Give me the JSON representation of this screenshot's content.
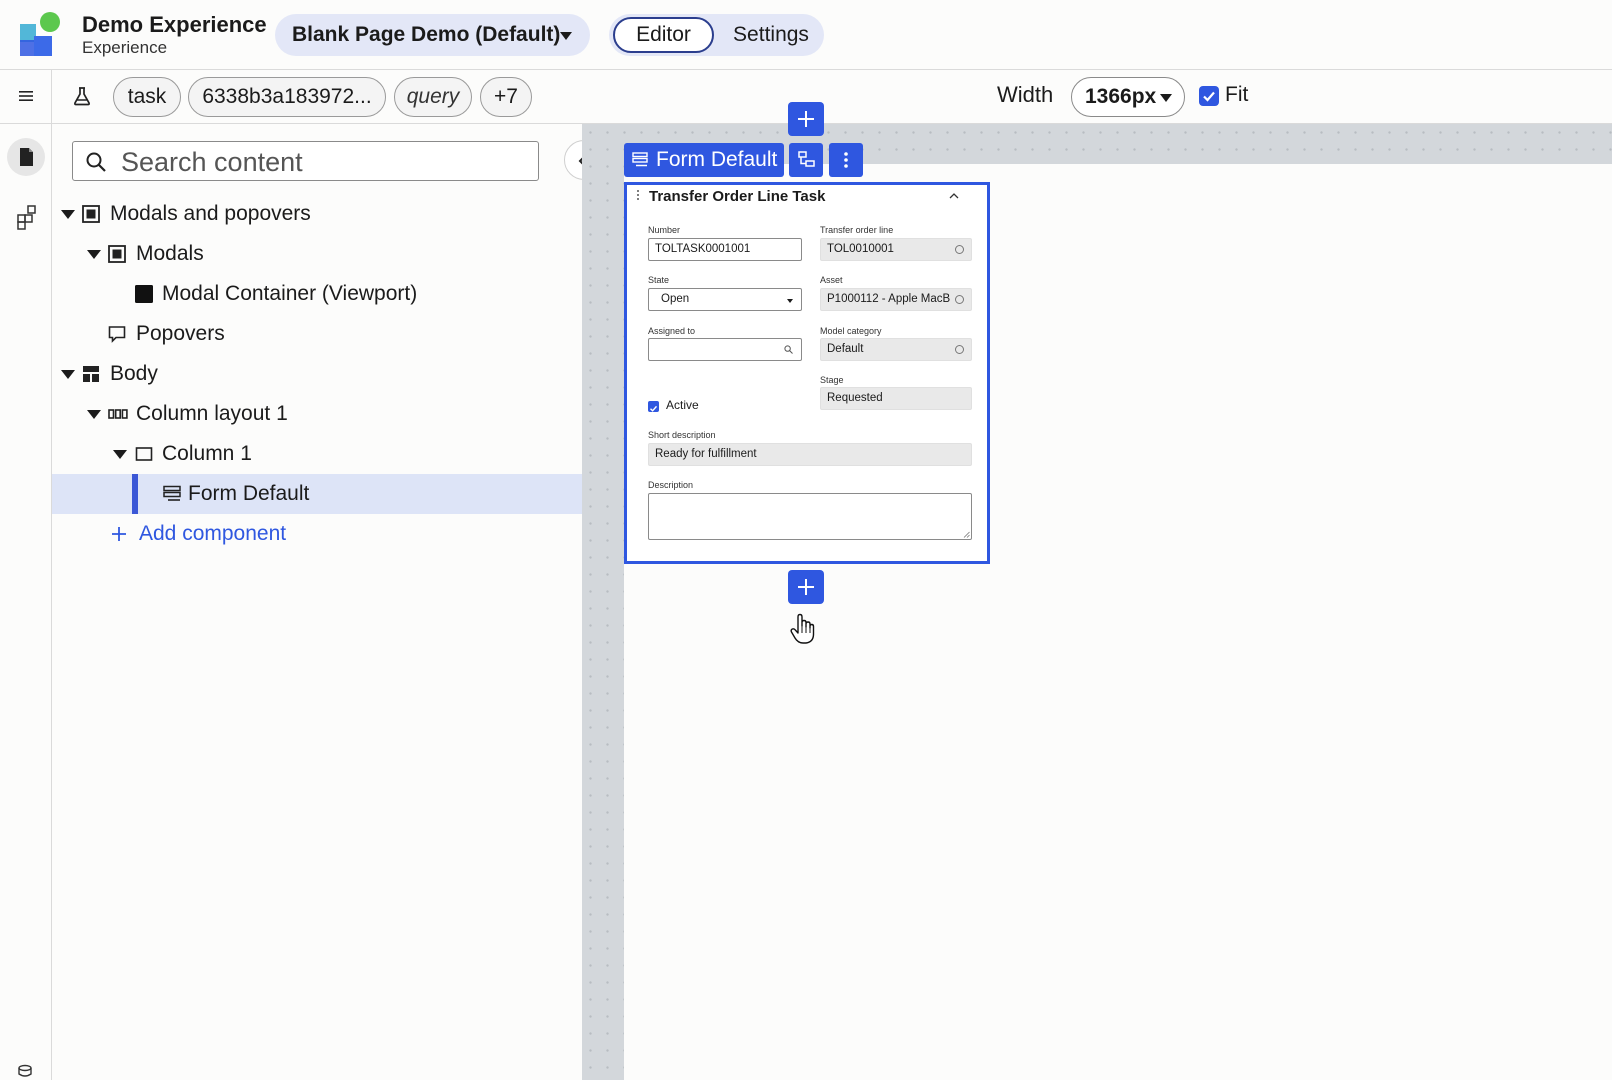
{
  "header": {
    "app_title": "Demo Experience",
    "app_subtitle": "Experience",
    "page_selector": "Blank Page Demo (Default)",
    "modes": {
      "editor": "Editor",
      "settings": "Settings"
    }
  },
  "toolbar": {
    "chips": [
      "task",
      "6338b3a183972...",
      "query",
      "+7"
    ],
    "width_label": "Width",
    "width_value": "1366px",
    "fit_label": "Fit",
    "fit_checked": true
  },
  "panel": {
    "search_placeholder": "Search content",
    "tree": [
      {
        "label": "Modals and popovers",
        "icon": "modal-icon",
        "expanded": true
      },
      {
        "label": "Modals",
        "icon": "modal-icon",
        "expanded": true
      },
      {
        "label": "Modal Container (Viewport)",
        "icon": "filled-square-icon"
      },
      {
        "label": "Popovers",
        "icon": "speech-bubble-icon"
      },
      {
        "label": "Body",
        "icon": "layout-icon",
        "expanded": true
      },
      {
        "label": "Column layout 1",
        "icon": "columns-icon",
        "expanded": true
      },
      {
        "label": "Column 1",
        "icon": "column-box-icon",
        "expanded": true
      },
      {
        "label": "Form Default",
        "icon": "form-icon",
        "selected": true
      }
    ],
    "add_component": "Add component"
  },
  "canvas": {
    "component_label": "Form Default",
    "form": {
      "title": "Transfer Order Line Task",
      "fields": {
        "number_label": "Number",
        "number_value": "TOLTASK0001001",
        "tol_label": "Transfer order line",
        "tol_value": "TOL0010001",
        "state_label": "State",
        "state_value": "Open",
        "asset_label": "Asset",
        "asset_value": "P1000112 - Apple MacB",
        "assigned_label": "Assigned to",
        "assigned_value": "",
        "model_label": "Model category",
        "model_value": "Default",
        "stage_label": "Stage",
        "stage_value": "Requested",
        "active_label": "Active",
        "short_desc_label": "Short description",
        "short_desc_value": "Ready for fulfillment",
        "desc_label": "Description"
      }
    }
  },
  "colors": {
    "accent": "#2f57e0",
    "pill_bg": "#e3e7f7",
    "selected_row": "#dde4f7",
    "canvas_gutter": "#d3d7db"
  }
}
